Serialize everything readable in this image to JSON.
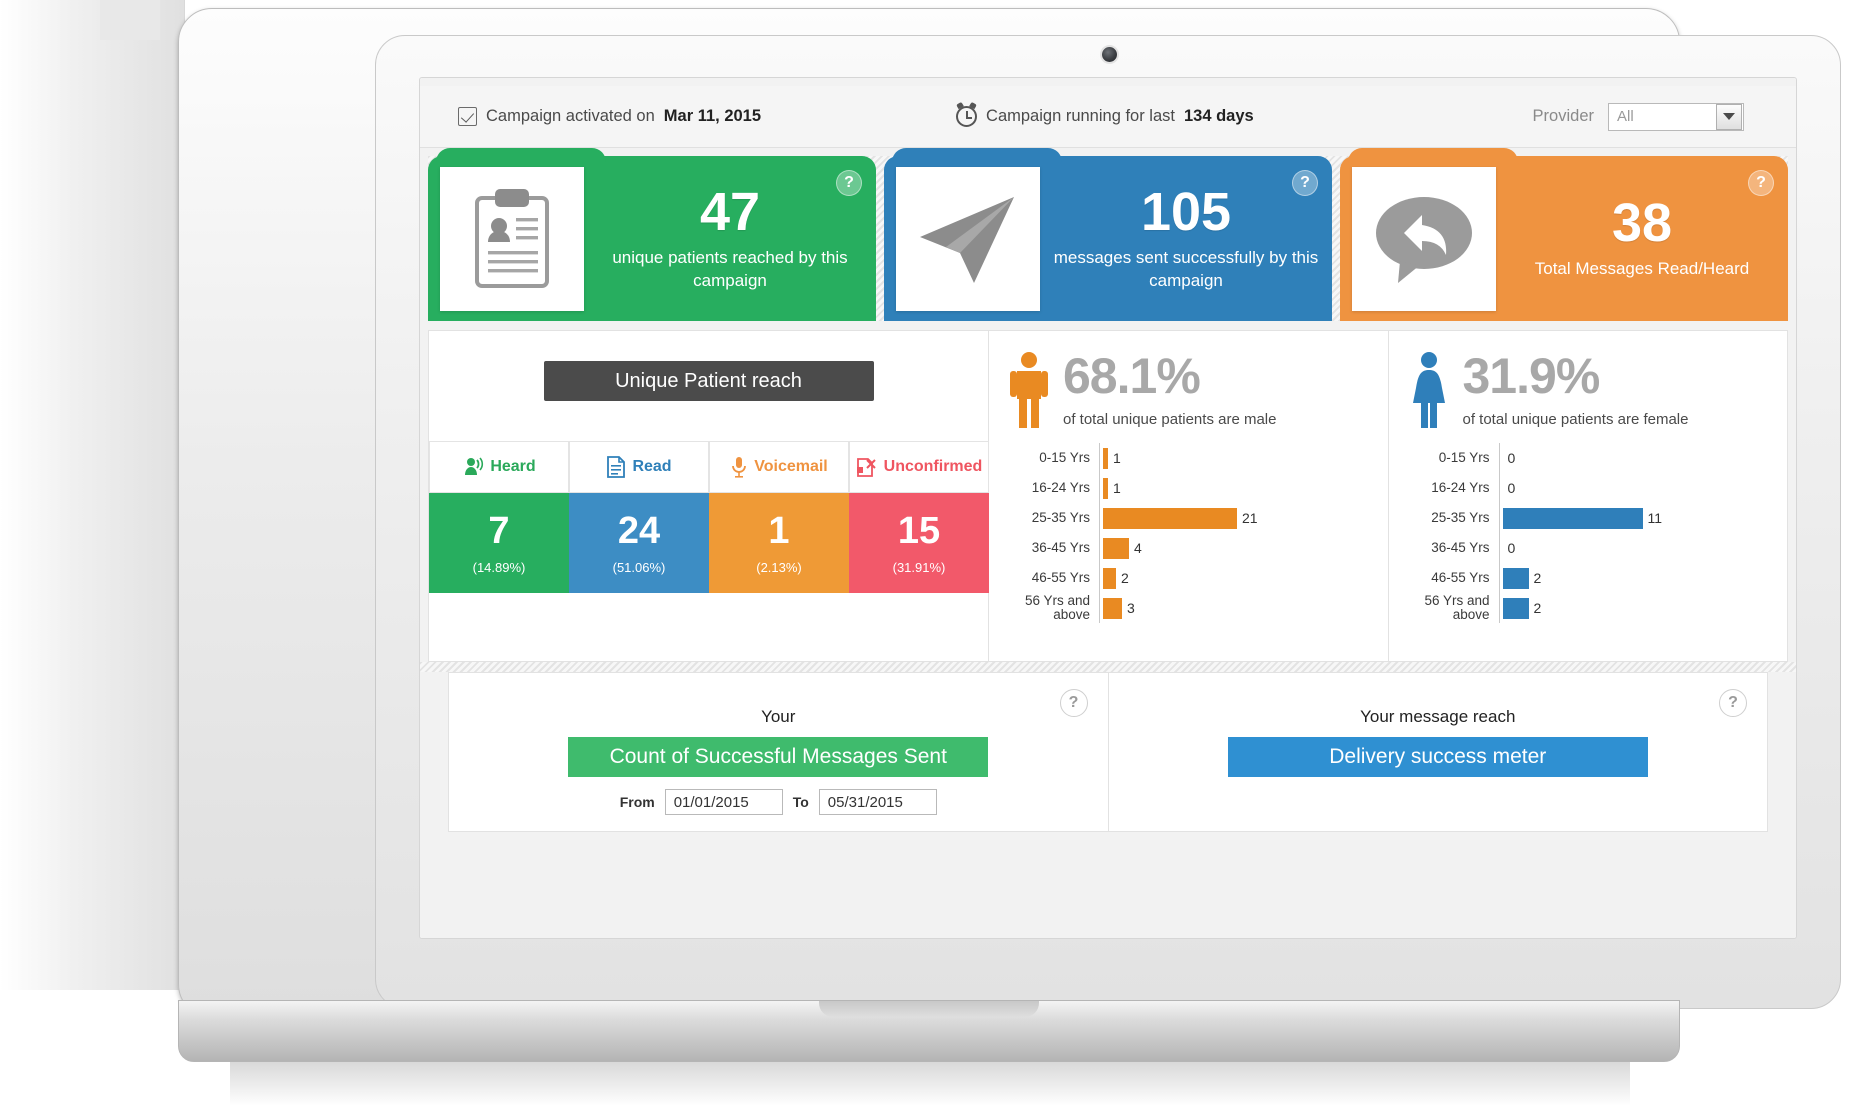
{
  "statusbar": {
    "activated_label": "Campaign activated on",
    "activated_date": "Mar 11, 2015",
    "running_label": "Campaign running for last",
    "running_days": "134 days",
    "provider_label": "Provider",
    "provider_value": "All"
  },
  "kpis": [
    {
      "value": "47",
      "label": "unique patients reached by this campaign",
      "color": "#27ae5f",
      "icon": "clipboard-patient-icon",
      "help": "?"
    },
    {
      "value": "105",
      "label": "messages sent successfully by this campaign",
      "color": "#2f80b9",
      "icon": "paper-plane-icon",
      "help": "?"
    },
    {
      "value": "38",
      "label": "Total Messages Read/Heard",
      "color": "#ef9340",
      "icon": "speech-bubble-reply-icon",
      "help": "?"
    }
  ],
  "unique_patient_reach": {
    "title": "Unique Patient reach",
    "statuses": [
      {
        "label": "Heard",
        "icon": "megaphone-icon",
        "value": "7",
        "percent": "(14.89%)",
        "color": "#27ae5f"
      },
      {
        "label": "Read",
        "icon": "document-icon",
        "value": "24",
        "percent": "(51.06%)",
        "color": "#3d8dc4"
      },
      {
        "label": "Voicemail",
        "icon": "microphone-icon",
        "value": "1",
        "percent": "(2.13%)",
        "color": "#ef9a36"
      },
      {
        "label": "Unconfirmed",
        "icon": "document-x-icon",
        "value": "15",
        "percent": "(31.91%)",
        "color": "#f2596a"
      }
    ]
  },
  "gender": {
    "male": {
      "percent": "68.1%",
      "caption": "of total unique patients are male",
      "icon": "male-figure-icon",
      "color": "#e98a22"
    },
    "female": {
      "percent": "31.9%",
      "caption": "of total unique patients are female",
      "icon": "female-figure-icon",
      "color": "#2f7fba"
    }
  },
  "bottom_panels": [
    {
      "subtitle": "Your",
      "banner": "Count of Successful Messages Sent",
      "color": "#3fbb6d",
      "from_label": "From",
      "from_value": "01/01/2015",
      "to_label": "To",
      "to_value": "05/31/2015",
      "help": "?"
    },
    {
      "subtitle": "Your message reach",
      "banner": "Delivery success meter",
      "color": "#2f90d2",
      "help": "?"
    }
  ],
  "chart_data": [
    {
      "type": "bar",
      "title": "Male patients by age group",
      "orientation": "horizontal",
      "categories": [
        "0-15 Yrs",
        "16-24 Yrs",
        "25-35 Yrs",
        "36-45 Yrs",
        "46-55 Yrs",
        "56 Yrs and above"
      ],
      "values": [
        1,
        1,
        21,
        4,
        2,
        3
      ],
      "series": [
        {
          "name": "Male",
          "values": [
            1,
            1,
            21,
            4,
            2,
            3
          ],
          "color": "#e98a22"
        }
      ],
      "xlabel": "",
      "ylabel": "",
      "xlim": [
        0,
        21
      ],
      "grid": false,
      "legend": false,
      "data_labels": [
        "1",
        "1",
        "21",
        "4",
        "2",
        "3"
      ]
    },
    {
      "type": "bar",
      "title": "Female patients by age group",
      "orientation": "horizontal",
      "categories": [
        "0-15 Yrs",
        "16-24 Yrs",
        "25-35 Yrs",
        "36-45 Yrs",
        "46-55 Yrs",
        "56 Yrs and above"
      ],
      "values": [
        0,
        0,
        11,
        0,
        2,
        2
      ],
      "series": [
        {
          "name": "Female",
          "values": [
            0,
            0,
            11,
            0,
            2,
            2
          ],
          "color": "#2f7fba"
        }
      ],
      "xlabel": "",
      "ylabel": "",
      "xlim": [
        0,
        11
      ],
      "grid": false,
      "legend": false,
      "data_labels": [
        "0",
        "0",
        "11",
        "0",
        "2",
        "2"
      ]
    },
    {
      "type": "bar",
      "title": "Unique Patient reach by message status",
      "categories": [
        "Heard",
        "Read",
        "Voicemail",
        "Unconfirmed"
      ],
      "values": [
        7,
        24,
        1,
        15
      ],
      "percentages": [
        14.89,
        51.06,
        2.13,
        31.91
      ],
      "colors": [
        "#27ae5f",
        "#3d8dc4",
        "#ef9a36",
        "#f2596a"
      ],
      "grid": false,
      "legend": false
    },
    {
      "type": "pie",
      "title": "Gender split of unique patients",
      "categories": [
        "Male",
        "Female"
      ],
      "values": [
        68.1,
        31.9
      ],
      "colors": [
        "#e98a22",
        "#2f7fba"
      ],
      "legend": false
    }
  ]
}
